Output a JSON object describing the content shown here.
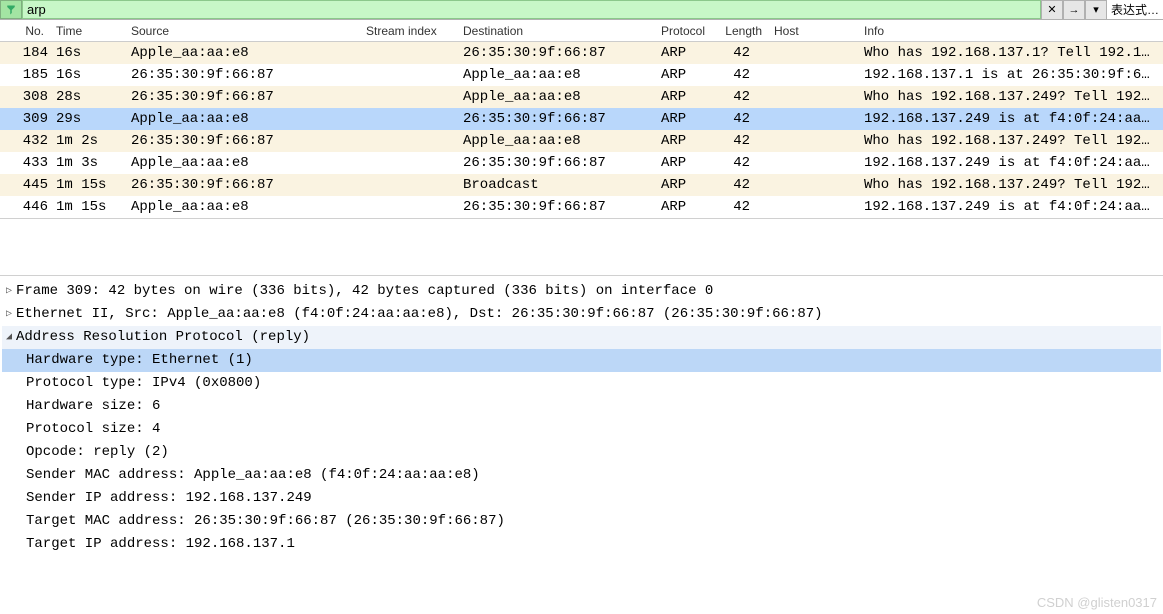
{
  "filter": {
    "value": "arp",
    "clear_label": "✕",
    "arrow_label": "→",
    "dropdown_label": "▾",
    "expression_label": "表达式…"
  },
  "columns": {
    "no": "No.",
    "time": "Time",
    "source": "Source",
    "stream": "Stream index",
    "destination": "Destination",
    "protocol": "Protocol",
    "length": "Length",
    "host": "Host",
    "info": "Info"
  },
  "packets": [
    {
      "no": "184",
      "time": "16s",
      "source": "Apple_aa:aa:e8",
      "stream": "",
      "destination": "26:35:30:9f:66:87",
      "protocol": "ARP",
      "length": "42",
      "host": "",
      "info": "Who has 192.168.137.1? Tell 192.1…",
      "cls": "bg-req"
    },
    {
      "no": "185",
      "time": "16s",
      "source": "26:35:30:9f:66:87",
      "stream": "",
      "destination": "Apple_aa:aa:e8",
      "protocol": "ARP",
      "length": "42",
      "host": "",
      "info": "192.168.137.1 is at 26:35:30:9f:6…",
      "cls": "bg-rep"
    },
    {
      "no": "308",
      "time": "28s",
      "source": "26:35:30:9f:66:87",
      "stream": "",
      "destination": "Apple_aa:aa:e8",
      "protocol": "ARP",
      "length": "42",
      "host": "",
      "info": "Who has 192.168.137.249? Tell 192…",
      "cls": "bg-req"
    },
    {
      "no": "309",
      "time": "29s",
      "source": "Apple_aa:aa:e8",
      "stream": "",
      "destination": "26:35:30:9f:66:87",
      "protocol": "ARP",
      "length": "42",
      "host": "",
      "info": "192.168.137.249 is at f4:0f:24:aa…",
      "cls": "selected"
    },
    {
      "no": "432",
      "time": "1m  2s",
      "source": "26:35:30:9f:66:87",
      "stream": "",
      "destination": "Apple_aa:aa:e8",
      "protocol": "ARP",
      "length": "42",
      "host": "",
      "info": "Who has 192.168.137.249? Tell 192…",
      "cls": "bg-req"
    },
    {
      "no": "433",
      "time": "1m  3s",
      "source": "Apple_aa:aa:e8",
      "stream": "",
      "destination": "26:35:30:9f:66:87",
      "protocol": "ARP",
      "length": "42",
      "host": "",
      "info": "192.168.137.249 is at f4:0f:24:aa…",
      "cls": "bg-rep"
    },
    {
      "no": "445",
      "time": "1m 15s",
      "source": "26:35:30:9f:66:87",
      "stream": "",
      "destination": "Broadcast",
      "protocol": "ARP",
      "length": "42",
      "host": "",
      "info": "Who has 192.168.137.249? Tell 192…",
      "cls": "bg-req"
    },
    {
      "no": "446",
      "time": "1m 15s",
      "source": "Apple_aa:aa:e8",
      "stream": "",
      "destination": "26:35:30:9f:66:87",
      "protocol": "ARP",
      "length": "42",
      "host": "",
      "info": "192.168.137.249 is at f4:0f:24:aa…",
      "cls": "bg-rep"
    }
  ],
  "details": {
    "frame": "Frame 309: 42 bytes on wire (336 bits), 42 bytes captured (336 bits) on interface 0",
    "eth": "Ethernet II, Src: Apple_aa:aa:e8 (f4:0f:24:aa:aa:e8), Dst: 26:35:30:9f:66:87 (26:35:30:9f:66:87)",
    "arp": "Address Resolution Protocol (reply)",
    "hw_type": "Hardware type: Ethernet (1)",
    "pr_type": "Protocol type: IPv4 (0x0800)",
    "hw_size": "Hardware size: 6",
    "pr_size": "Protocol size: 4",
    "opcode": "Opcode: reply (2)",
    "s_mac": "Sender MAC address: Apple_aa:aa:e8 (f4:0f:24:aa:aa:e8)",
    "s_ip": "Sender IP address: 192.168.137.249",
    "t_mac": "Target MAC address: 26:35:30:9f:66:87 (26:35:30:9f:66:87)",
    "t_ip": "Target IP address: 192.168.137.1"
  },
  "watermark": "CSDN @glisten0317"
}
